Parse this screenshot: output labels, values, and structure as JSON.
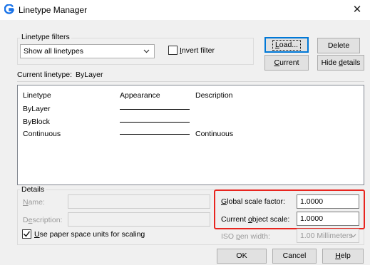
{
  "window": {
    "title": "Linetype Manager",
    "close_glyph": "✕",
    "app_icon": "gstarcad-logo-icon"
  },
  "filters": {
    "group_title": "Linetype filters",
    "selected": "Show all linetypes",
    "invert_label_prefix": "",
    "invert_label_u": "I",
    "invert_label_rest": "nvert filter",
    "invert_checked": false
  },
  "buttons": {
    "load_u": "L",
    "load_rest": "oad...",
    "delete": "Delete",
    "current_u": "C",
    "current_rest": "urrent",
    "hide_details_prefix": "Hide ",
    "hide_details_u": "d",
    "hide_details_rest": "etails",
    "ok": "OK",
    "cancel": "Cancel",
    "help_u": "H",
    "help_rest": "elp"
  },
  "current_linetype": {
    "label": "Current linetype:",
    "value": "ByLayer"
  },
  "list": {
    "headers": [
      "Linetype",
      "Appearance",
      "Description"
    ],
    "rows": [
      {
        "name": "ByLayer",
        "has_line": true,
        "description": ""
      },
      {
        "name": "ByBlock",
        "has_line": true,
        "description": ""
      },
      {
        "name": "Continuous",
        "has_line": true,
        "description": "Continuous"
      }
    ]
  },
  "details": {
    "group_title": "Details",
    "name_u": "N",
    "name_rest": "ame:",
    "description_prefix": "D",
    "description_u": "e",
    "description_rest": "scription:",
    "name_value": "",
    "description_value": "",
    "paper_space_u": "U",
    "paper_space_rest": "se paper space units for scaling",
    "paper_space_checked": true,
    "global_scale_u": "G",
    "global_scale_rest": "lobal scale factor:",
    "global_scale_value": "1.0000",
    "current_scale_prefix": "Current ",
    "current_scale_u": "o",
    "current_scale_rest": "bject scale:",
    "current_scale_value": "1.0000",
    "iso_pen_prefix": "ISO ",
    "iso_pen_u": "p",
    "iso_pen_rest": "en width:",
    "iso_pen_value": "1.00 Millimeters"
  },
  "colors": {
    "highlight": "#e8251f",
    "accent": "#0078d7"
  }
}
